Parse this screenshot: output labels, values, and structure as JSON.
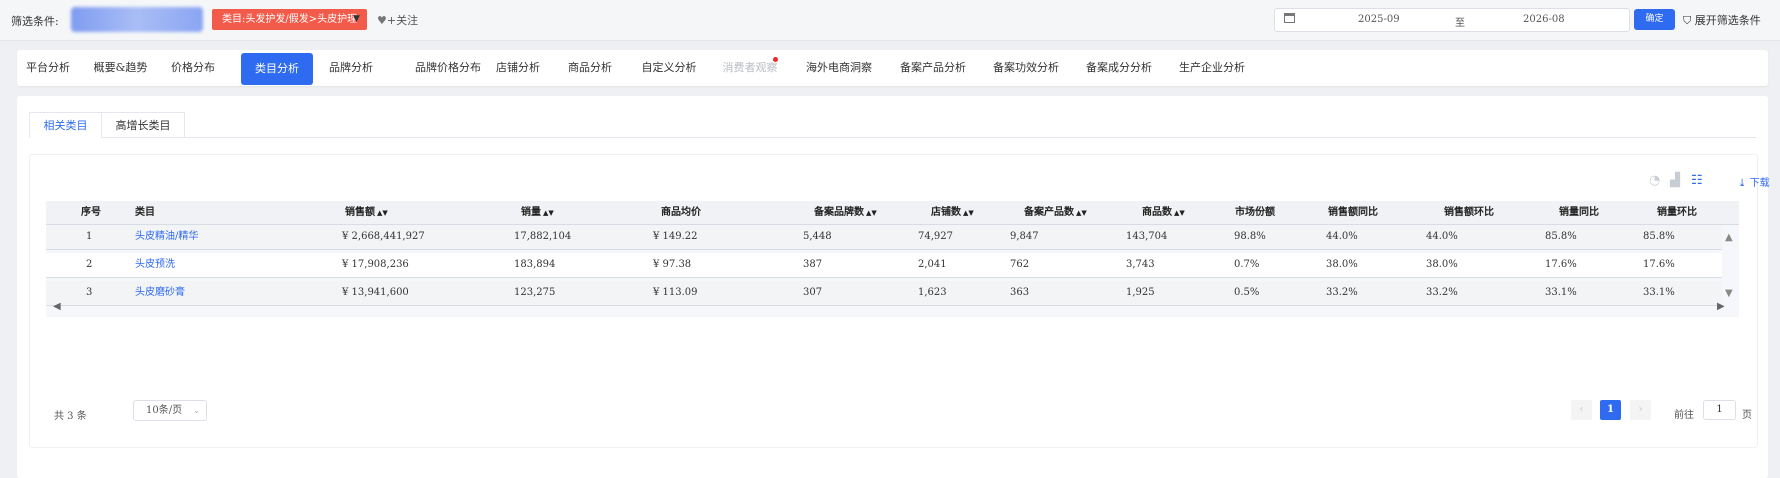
{
  "filter": {
    "label": "筛选条件:",
    "category_tag": "类目:头发护发/假发>头皮护理",
    "follow": "关注",
    "date_start": "2025-09",
    "date_to": "至",
    "date_end": "2026-08",
    "confirm": "确定",
    "expand": "展开筛选条件"
  },
  "nav": {
    "tabs": [
      {
        "label": "平台分析"
      },
      {
        "label": "概要&趋势"
      },
      {
        "label": "价格分布"
      },
      {
        "label": "类目分析",
        "active": true
      },
      {
        "label": "品牌分析"
      },
      {
        "label": "品牌价格分布"
      },
      {
        "label": "店铺分析"
      },
      {
        "label": "商品分析"
      },
      {
        "label": "自定义分析"
      },
      {
        "label": "消费者观察",
        "disabled": true
      },
      {
        "label": "海外电商洞察"
      },
      {
        "label": "备案产品分析"
      },
      {
        "label": "备案功效分析"
      },
      {
        "label": "备案成分分析"
      },
      {
        "label": "生产企业分析"
      }
    ]
  },
  "subtabs": [
    {
      "label": "相关类目",
      "active": true
    },
    {
      "label": "高增长类目"
    }
  ],
  "toolbar": {
    "download": "下载",
    "icons": [
      "pie-chart-icon",
      "bar-chart-icon",
      "table-view-icon"
    ]
  },
  "table": {
    "headers": [
      "序号",
      "类目",
      "销售额",
      "销量",
      "商品均价",
      "备案品牌数",
      "店铺数",
      "备案产品数",
      "商品数",
      "市场份额",
      "销售额同比",
      "销售额环比",
      "销量同比",
      "销量环比"
    ],
    "rows": [
      [
        "1",
        "头皮精油/精华",
        "¥ 2,668,441,927",
        "17,882,104",
        "¥ 149.22",
        "5,448",
        "74,927",
        "9,847",
        "143,704",
        "98.8%",
        "44.0%",
        "44.0%",
        "85.8%",
        "85.8%"
      ],
      [
        "2",
        "头皮预洗",
        "¥ 17,908,236",
        "183,894",
        "¥ 97.38",
        "387",
        "2,041",
        "762",
        "3,743",
        "0.7%",
        "38.0%",
        "38.0%",
        "17.6%",
        "17.6%"
      ],
      [
        "3",
        "头皮磨砂膏",
        "¥ 13,941,600",
        "123,275",
        "¥ 113.09",
        "307",
        "1,623",
        "363",
        "1,925",
        "0.5%",
        "33.2%",
        "33.2%",
        "33.1%",
        "33.1%"
      ]
    ]
  },
  "pagination": {
    "total": "共 3 条",
    "page_size": "10条/页",
    "current_page": "1",
    "goto_label": "前往",
    "goto_value": "1",
    "page_unit": "页"
  }
}
